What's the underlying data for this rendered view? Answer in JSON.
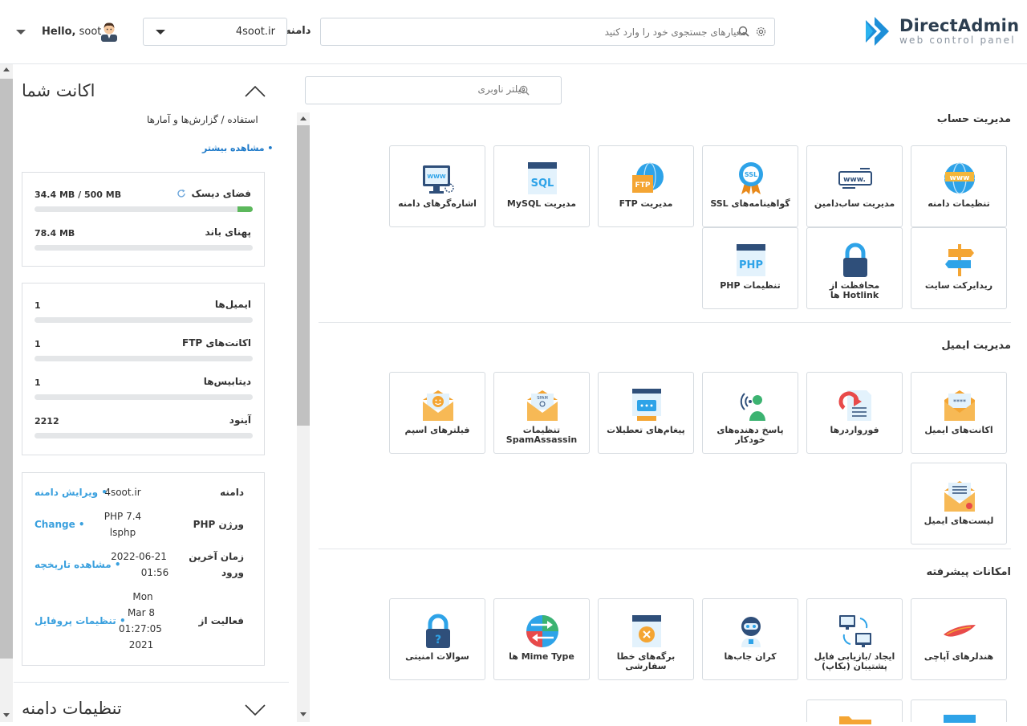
{
  "header": {
    "logo_title": "DirectAdmin",
    "logo_subtitle": "web control panel",
    "search_placeholder": "معیارهای جستجوی خود را وارد کنید",
    "domain_label": "دامنه",
    "domain_value": "4soot.ir",
    "greeting": "Hello,",
    "username": "soot"
  },
  "sidebar": {
    "account_title": "اکانت شما",
    "usage_line": "استفاده / گزارش‌ها و آمارها",
    "see_more": "• مشاهده بیشتر",
    "disk": {
      "label": "فضای دیسک",
      "value": "34.4 MB / 500 MB",
      "fill_fraction": 0.069
    },
    "bandwidth": {
      "label": "پهنای باند",
      "value": "78.4 MB",
      "fill_fraction": 0
    },
    "stats": [
      {
        "label": "ایمیل‌ها",
        "value": "1"
      },
      {
        "label": "اکانت‌های FTP",
        "value": "1"
      },
      {
        "label": "دیتابیس‌ها",
        "value": "1"
      },
      {
        "label": "آینود",
        "value": "2212"
      }
    ],
    "info": {
      "domain_label": "دامنه",
      "domain_value": "4soot.ir",
      "domain_link": "• ویرایش دامنه",
      "php_label": "ورژن PHP",
      "php_value_line1": "PHP 7.4",
      "php_value_line2": "lsphp",
      "php_link": "• Change",
      "login_label_line1": "زمان آخرین",
      "login_label_line2": "ورود",
      "login_value_line1": "2022-06-21",
      "login_value_line2": "01:56",
      "login_link": "• مشاهده تاریخچه",
      "active_label": "فعالیت از",
      "active_line1": "Mon",
      "active_line2": "Mar 8",
      "active_line3": "01:27:05",
      "active_line4": "2021",
      "active_link": "• تنظیمات پروفایل"
    },
    "domain_settings_title": "تنظیمات دامنه"
  },
  "main": {
    "filter_placeholder": "فیلتر ناوبری",
    "sections": [
      {
        "title": "مدیریت حساب",
        "tiles": [
          {
            "label": "تنظیمات دامنه",
            "icon": "globe-www-icon"
          },
          {
            "label": "مدیریت ساب‌دامین",
            "icon": "subdomain-icon"
          },
          {
            "label": "گواهینامه‌های SSL",
            "icon": "ssl-badge-icon"
          },
          {
            "label": "مدیریت FTP",
            "icon": "ftp-icon"
          },
          {
            "label": "مدیریت MySQL",
            "icon": "sql-icon"
          },
          {
            "label": "اشاره‌گرهای دامنه",
            "icon": "domain-pointer-icon"
          },
          {
            "label": "ریدایرکت سایت",
            "icon": "signpost-icon"
          },
          {
            "label": "محافظت از Hotlink ها",
            "icon": "lock-icon"
          },
          {
            "label": "تنظیمات PHP",
            "icon": "php-icon"
          }
        ]
      },
      {
        "title": "مدیریت ایمیل",
        "tiles": [
          {
            "label": "اکانت‌های ایمیل",
            "icon": "email-account-icon"
          },
          {
            "label": "فورواردرها",
            "icon": "forwarder-icon"
          },
          {
            "label": "پاسخ دهنده‌های خودکار",
            "icon": "autoresponder-icon"
          },
          {
            "label": "پیغام‌های تعطیلات",
            "icon": "vacation-message-icon"
          },
          {
            "label": "تنظیمات SpamAssassin",
            "icon": "spam-envelope-icon"
          },
          {
            "label": "فیلترهای اسپم",
            "icon": "spam-filter-icon"
          },
          {
            "label": "لیست‌های ایمیل",
            "icon": "mailing-list-icon"
          }
        ]
      },
      {
        "title": "امکانات پیشرفته",
        "tiles": [
          {
            "label": "هندلرهای آپاچی",
            "icon": "apache-feather-icon"
          },
          {
            "label": "ایجاد /بازیابی فایل پشتیبان (بکاپ)",
            "icon": "backup-icon"
          },
          {
            "label": "کران جاب‌ها",
            "icon": "cron-robot-icon"
          },
          {
            "label": "برگه‌های خطا سفارشی",
            "icon": "error-page-icon"
          },
          {
            "label": "Mime Type ها",
            "icon": "mime-type-icon"
          },
          {
            "label": "سوالات امنیتی",
            "icon": "security-question-icon"
          }
        ]
      }
    ]
  }
}
